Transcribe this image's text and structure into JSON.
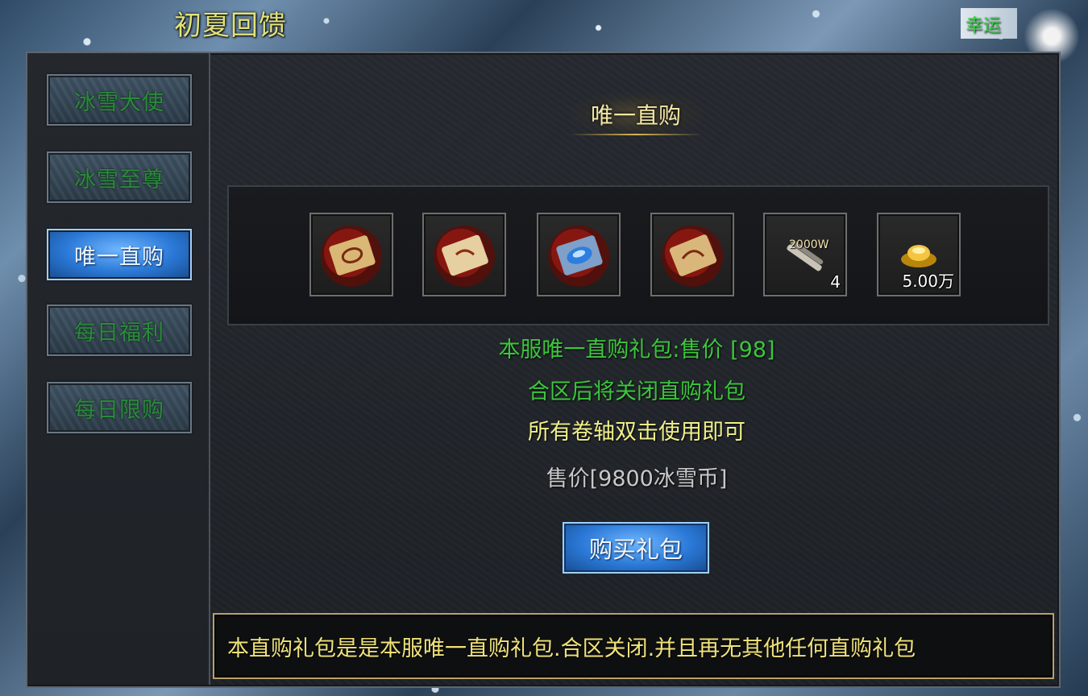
{
  "window": {
    "title": "初夏回馈",
    "corner_label": "幸运"
  },
  "sidebar": {
    "items": [
      {
        "label": "冰雪大使",
        "active": false
      },
      {
        "label": "冰雪至尊",
        "active": false
      },
      {
        "label": "唯一直购",
        "active": true
      },
      {
        "label": "每日福利",
        "active": false
      },
      {
        "label": "每日限购",
        "active": false
      }
    ]
  },
  "main": {
    "section_title": "唯一直购",
    "rewards": [
      {
        "icon": "red-scroll-icon",
        "count": ""
      },
      {
        "icon": "red-scroll-icon",
        "count": ""
      },
      {
        "icon": "blue-scroll-icon",
        "count": ""
      },
      {
        "icon": "red-scroll-icon",
        "count": ""
      },
      {
        "icon": "exp-scroll-icon",
        "tag": "2000W",
        "count": "4"
      },
      {
        "icon": "gold-ingot-icon",
        "count": "5.00万"
      }
    ],
    "line1": "本服唯一直购礼包:售价 [98]",
    "line2": "合区后将关闭直购礼包",
    "line3": "所有卷轴双击使用即可",
    "price": "售价[9800冰雪币]",
    "buy_label": "购买礼包",
    "notice": "本直购礼包是是本服唯一直购礼包.合区关闭.并且再无其他任何直购礼包"
  },
  "colors": {
    "green_text": "#3cc63c",
    "yellow_text": "#f0f08a",
    "active_blue": "#2a78d6"
  }
}
